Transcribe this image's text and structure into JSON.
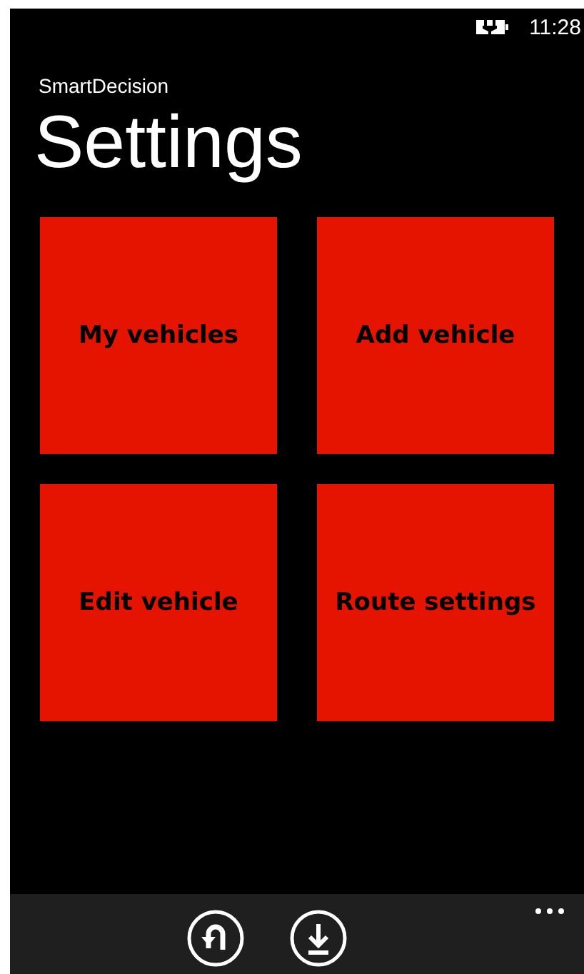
{
  "status_bar": {
    "time": "11:28"
  },
  "app_title": "SmartDecision",
  "page_title": "Settings",
  "tiles": [
    {
      "label": "My vehicles"
    },
    {
      "label": "Add vehicle"
    },
    {
      "label": "Edit vehicle"
    },
    {
      "label": "Route settings"
    }
  ],
  "app_bar": {
    "buttons": [
      {
        "kind": "undo"
      },
      {
        "kind": "download"
      }
    ]
  }
}
